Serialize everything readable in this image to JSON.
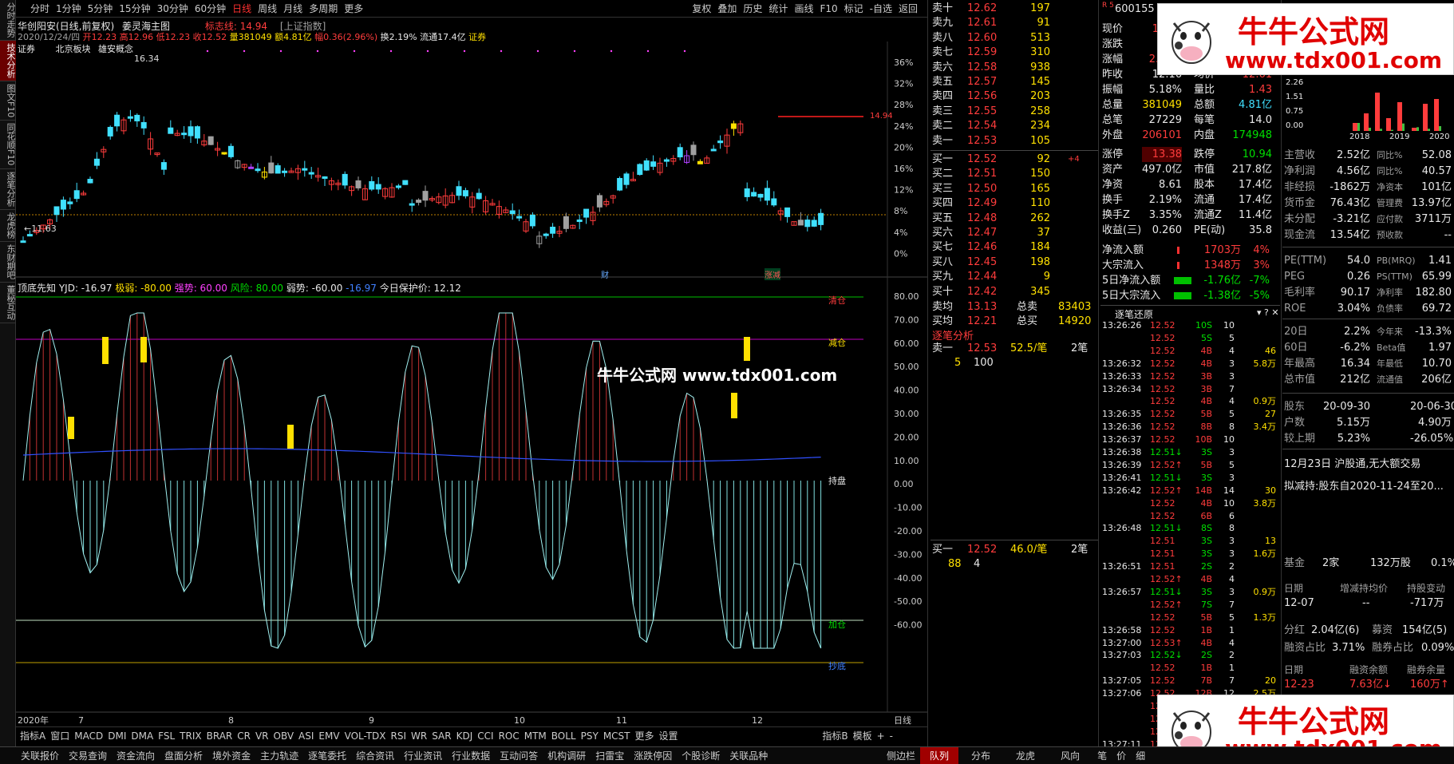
{
  "left_tabs": [
    "分时走势",
    "技术分析",
    "图文F10",
    "同花顺F10",
    "逐笔分析",
    "龙虎榜",
    "东财期吧",
    "董秘互动"
  ],
  "top_periods": [
    "分时",
    "1分钟",
    "5分钟",
    "15分钟",
    "30分钟",
    "60分钟",
    "日线",
    "周线",
    "月线",
    "多周期",
    "更多"
  ],
  "top_tools": [
    "复权",
    "叠加",
    "历史",
    "统计",
    "画线",
    "F10",
    "标记",
    "-自选",
    "返回"
  ],
  "stock": {
    "name": "华创阳安(日线,前复权)",
    "indicator_name": "姜灵海主图",
    "mark_line": "标志线: 14.94",
    "index_ref": "[上证指数]",
    "info_line_date": "2020/12/24/四",
    "open": "开12.23",
    "high": "高12.96",
    "low": "低12.23",
    "close": "收12.52",
    "vol": "量381049",
    "amt": "额4.81亿",
    "chg": "幅0.36(2.96%)",
    "turnover": "换2.19%",
    "float": "流通17.4亿",
    "sector": "证券",
    "sector2": "证券",
    "block": "北京板块",
    "block2": "雄安概念",
    "low_label": "←11.63",
    "high_label": "16.34",
    "right_label": "14.94",
    "tag1": "财",
    "tag2": "涨减"
  },
  "price_axis": [
    "36%",
    "32%",
    "28%",
    "24%",
    "20%",
    "16%",
    "12%",
    "8%",
    "4%",
    "0%"
  ],
  "osc": {
    "title": "顶底先知",
    "yjd": "YJD: -16.97",
    "jj": "极弱: -80.00",
    "qs": "强势: 60.00",
    "fx": "风险: 80.00",
    "rs": "弱势: -60.00",
    "blue": "-16.97",
    "protect": "今日保护价: 12.12",
    "axis": [
      "80.00",
      "70.00",
      "60.00",
      "50.00",
      "40.00",
      "30.00",
      "20.00",
      "10.00",
      "0.00",
      "-10.00",
      "-20.00",
      "-30.00",
      "-40.00",
      "-50.00",
      "-60.00"
    ],
    "labels": {
      "qingcang": "清仓",
      "jiancang": "减仓",
      "chipan": "持盘",
      "jiacang": "加仓",
      "jd": "抄底"
    }
  },
  "watermark_mid": "牛牛公式网 www.tdx001.com",
  "watermark_ad": {
    "title": "牛牛公式网",
    "url": "www.tdx001.com"
  },
  "x_axis": [
    "2020年",
    "7",
    "8",
    "9",
    "10",
    "11",
    "12"
  ],
  "x_right": "日线",
  "ind_tabs": [
    "指标A",
    "窗口",
    "MACD",
    "DMI",
    "DMA",
    "FSL",
    "TRIX",
    "BRAR",
    "CR",
    "VR",
    "OBV",
    "ASI",
    "EMV",
    "VOL-TDX",
    "RSI",
    "WR",
    "SAR",
    "KDJ",
    "CCI",
    "ROC",
    "MTM",
    "BOLL",
    "PSY",
    "MCST",
    "更多",
    "设置"
  ],
  "ind_right": [
    "指标B",
    "模板",
    "+",
    "-"
  ],
  "order_book": {
    "sells": [
      [
        "卖十",
        "12.62",
        "197"
      ],
      [
        "卖九",
        "12.61",
        "91"
      ],
      [
        "卖八",
        "12.60",
        "513"
      ],
      [
        "卖七",
        "12.59",
        "310"
      ],
      [
        "卖六",
        "12.58",
        "938"
      ],
      [
        "卖五",
        "12.57",
        "145"
      ],
      [
        "卖四",
        "12.56",
        "203"
      ],
      [
        "卖三",
        "12.55",
        "258"
      ],
      [
        "卖二",
        "12.54",
        "234"
      ],
      [
        "卖一",
        "12.53",
        "105"
      ]
    ],
    "buys": [
      [
        "买一",
        "12.52",
        "92",
        "+4"
      ],
      [
        "买二",
        "12.51",
        "150",
        ""
      ],
      [
        "买三",
        "12.50",
        "165",
        ""
      ],
      [
        "买四",
        "12.49",
        "110",
        ""
      ],
      [
        "买五",
        "12.48",
        "262",
        ""
      ],
      [
        "买六",
        "12.47",
        "37",
        ""
      ],
      [
        "买七",
        "12.46",
        "184",
        ""
      ],
      [
        "买八",
        "12.45",
        "198",
        ""
      ],
      [
        "买九",
        "12.44",
        "9",
        ""
      ],
      [
        "买十",
        "12.42",
        "345",
        ""
      ]
    ],
    "avg": [
      [
        "卖均",
        "13.13",
        "总卖",
        "83403"
      ],
      [
        "买均",
        "12.21",
        "总买",
        "14920"
      ]
    ],
    "trade_title": "逐笔分析",
    "sell1": {
      "label": "卖一",
      "price": "12.53",
      "per": "52.5/笔",
      "n": "2笔",
      "q1": "5",
      "q2": "100"
    },
    "buy1": {
      "label": "买一",
      "price": "12.52",
      "per": "46.0/笔",
      "n": "2笔",
      "q1": "88",
      "q2": "4"
    }
  },
  "quote": {
    "code": "600155",
    "rows": [
      [
        "现价",
        "12.52",
        "今开",
        "12.23"
      ],
      [
        "涨跌",
        "0.36",
        "最高",
        "12.96"
      ],
      [
        "涨幅",
        "2.96%",
        "最低",
        "12.23"
      ],
      [
        "昨收",
        "12.16",
        "均价",
        "12.61"
      ],
      [
        "振幅",
        "5.18%",
        "量比",
        "1.43"
      ],
      [
        "总量",
        "381049",
        "总额",
        "4.81亿"
      ],
      [
        "总笔",
        "27229",
        "每笔",
        "14.0"
      ],
      [
        "外盘",
        "206101",
        "内盘",
        "174948"
      ]
    ],
    "rows2": [
      [
        "涨停",
        "13.38",
        "跌停",
        "10.94"
      ],
      [
        "资产",
        "497.0亿",
        "市值",
        "217.8亿"
      ],
      [
        "净资",
        "8.61",
        "股本",
        "17.4亿"
      ],
      [
        "换手",
        "2.19%",
        "流通",
        "17.4亿"
      ],
      [
        "换手Z",
        "3.35%",
        "流通Z",
        "11.4亿"
      ],
      [
        "收益(三)",
        "0.260",
        "PE(动)",
        "35.8"
      ]
    ],
    "flows": [
      [
        "净流入额",
        "1703万",
        "4%"
      ],
      [
        "大宗流入",
        "1348万",
        "3%"
      ],
      [
        "5日净流入额",
        "-1.76亿",
        "-7%"
      ],
      [
        "5日大宗流入",
        "-1.38亿",
        "-5%"
      ]
    ],
    "tick_title": "逐笔还原"
  },
  "ticks": [
    [
      "13:26:26",
      "12.52",
      "10S",
      "10",
      ""
    ],
    [
      "",
      "12.52",
      "5S",
      "5",
      ""
    ],
    [
      "",
      "12.52",
      "4B",
      "4",
      "46"
    ],
    [
      "13:26:32",
      "12.52",
      "4B",
      "3",
      "5.8万"
    ],
    [
      "13:26:33",
      "12.52",
      "3B",
      "3",
      ""
    ],
    [
      "13:26:34",
      "12.52",
      "3B",
      "7",
      ""
    ],
    [
      "",
      "12.52",
      "4B",
      "4",
      "0.9万"
    ],
    [
      "13:26:35",
      "12.52",
      "5B",
      "5",
      "27"
    ],
    [
      "13:26:36",
      "12.52",
      "8B",
      "8",
      "3.4万"
    ],
    [
      "13:26:37",
      "12.52",
      "10B",
      "10",
      ""
    ],
    [
      "13:26:38",
      "12.51↓",
      "3S",
      "3",
      ""
    ],
    [
      "13:26:39",
      "12.52↑",
      "5B",
      "5",
      ""
    ],
    [
      "13:26:41",
      "12.51↓",
      "3S",
      "3",
      ""
    ],
    [
      "13:26:42",
      "12.52↑",
      "14B",
      "14",
      "30"
    ],
    [
      "",
      "12.52",
      "4B",
      "10",
      "3.8万"
    ],
    [
      "",
      "12.52",
      "6B",
      "6",
      ""
    ],
    [
      "13:26:48",
      "12.51↓",
      "8S",
      "8",
      ""
    ],
    [
      "",
      "12.51",
      "3S",
      "3",
      "13"
    ],
    [
      "",
      "12.51",
      "3S",
      "3",
      "1.6万"
    ],
    [
      "13:26:51",
      "12.51",
      "2S",
      "2",
      ""
    ],
    [
      "",
      "12.52↑",
      "4B",
      "4",
      ""
    ],
    [
      "13:26:57",
      "12.51↓",
      "3S",
      "3",
      "0.9万"
    ],
    [
      "",
      "12.52↑",
      "7S",
      "7",
      ""
    ],
    [
      "",
      "12.52",
      "5B",
      "5",
      "1.3万"
    ],
    [
      "13:26:58",
      "12.52",
      "1B",
      "1",
      ""
    ],
    [
      "13:27:00",
      "12.53↑",
      "4B",
      "4",
      ""
    ],
    [
      "13:27:03",
      "12.52↓",
      "2S",
      "2",
      ""
    ],
    [
      "",
      "12.52",
      "1B",
      "1",
      ""
    ],
    [
      "13:27:05",
      "12.52",
      "7B",
      "7",
      "20"
    ],
    [
      "13:27:06",
      "12.52",
      "12B",
      "12",
      "2.5万"
    ],
    [
      "",
      "12.53↑",
      "17B",
      "17",
      ""
    ],
    [
      "",
      "12.53",
      "18B",
      "18",
      "50"
    ],
    [
      "",
      "12.53",
      "",
      "",
      "6.3万"
    ],
    [
      "13:27:11",
      "12.53",
      "",
      ""
    ],
    [
      "",
      "12.53",
      "",
      ""
    ]
  ],
  "fin": {
    "years": [
      "2018",
      "2019",
      "2020"
    ],
    "bar_axis": [
      "2.26",
      "1.51",
      "0.75",
      "0.00"
    ],
    "rows": [
      [
        "主营收",
        "2.52亿",
        "同比%",
        "52.08"
      ],
      [
        "净利润",
        "4.56亿",
        "同比%",
        "40.57"
      ],
      [
        "非经损",
        "-1862万",
        "净资本",
        "101亿"
      ],
      [
        "货币金",
        "76.43亿",
        "管理费",
        "13.97亿"
      ],
      [
        "未分配",
        "-3.21亿",
        "应付款",
        "3711万"
      ],
      [
        "现金流",
        "13.54亿",
        "预收款",
        "--"
      ]
    ],
    "rows2": [
      [
        "PE(TTM)",
        "54.0",
        "PB(MRQ)",
        "1.41"
      ],
      [
        "PEG",
        "0.26",
        "PS(TTM)",
        "65.99"
      ],
      [
        "毛利率",
        "90.17",
        "净利率",
        "182.80"
      ],
      [
        "ROE",
        "3.04%",
        "负债率",
        "69.72"
      ]
    ],
    "rows3": [
      [
        "20日",
        "2.2%",
        "今年来",
        "-13.3%"
      ],
      [
        "60日",
        "-6.2%",
        "Beta值",
        "1.97"
      ],
      [
        "年最高",
        "16.34",
        "年最低",
        "10.70"
      ],
      [
        "总市值",
        "212亿",
        "流通值",
        "206亿"
      ]
    ],
    "rows4": [
      [
        "股东",
        "20-09-30",
        "",
        "20-06-30"
      ],
      [
        "户数",
        "5.15万",
        "",
        "4.90万"
      ],
      [
        "较上期",
        "5.23%",
        "",
        "-26.05%"
      ]
    ],
    "news": [
      "12月23日 沪股通,无大额交易",
      "拟减持:股东自2020-11-24至20..."
    ],
    "fund": [
      "基金",
      "2家",
      "132万股",
      "0.1%"
    ],
    "hold": [
      "日期",
      "增减持均价",
      "持股变动"
    ],
    "hold_row": [
      "12-07",
      "--",
      "-717万"
    ],
    "div": [
      "分红",
      "2.04亿(6)",
      "募资",
      "154亿(5)"
    ],
    "margin": [
      "融资占比",
      "3.71%",
      "融券占比",
      "0.09%"
    ],
    "margin_hdr": [
      "日期",
      "融资余额",
      "融券余量"
    ],
    "margin_row": [
      "12-23",
      "7.63亿↓",
      "160万↑"
    ]
  },
  "bottom_tabs": [
    "关联报价",
    "交易查询",
    "资金流向",
    "盘面分析",
    "境外资金",
    "主力轨迹",
    "逐笔委托",
    "综合资讯",
    "行业资讯",
    "行业数据",
    "互动问答",
    "机构调研",
    "扫雷宝",
    "涨跌停因",
    "个股诊断",
    "关联品种"
  ],
  "bottom_right": [
    "侧边栏",
    "队列",
    "分布",
    "龙虎",
    "风向",
    "笔",
    "价",
    "细"
  ],
  "colors": {
    "up": "#ff3c3c",
    "down": "#40e0ff",
    "accent": "#ffe000",
    "magenta": "#c040ff"
  }
}
